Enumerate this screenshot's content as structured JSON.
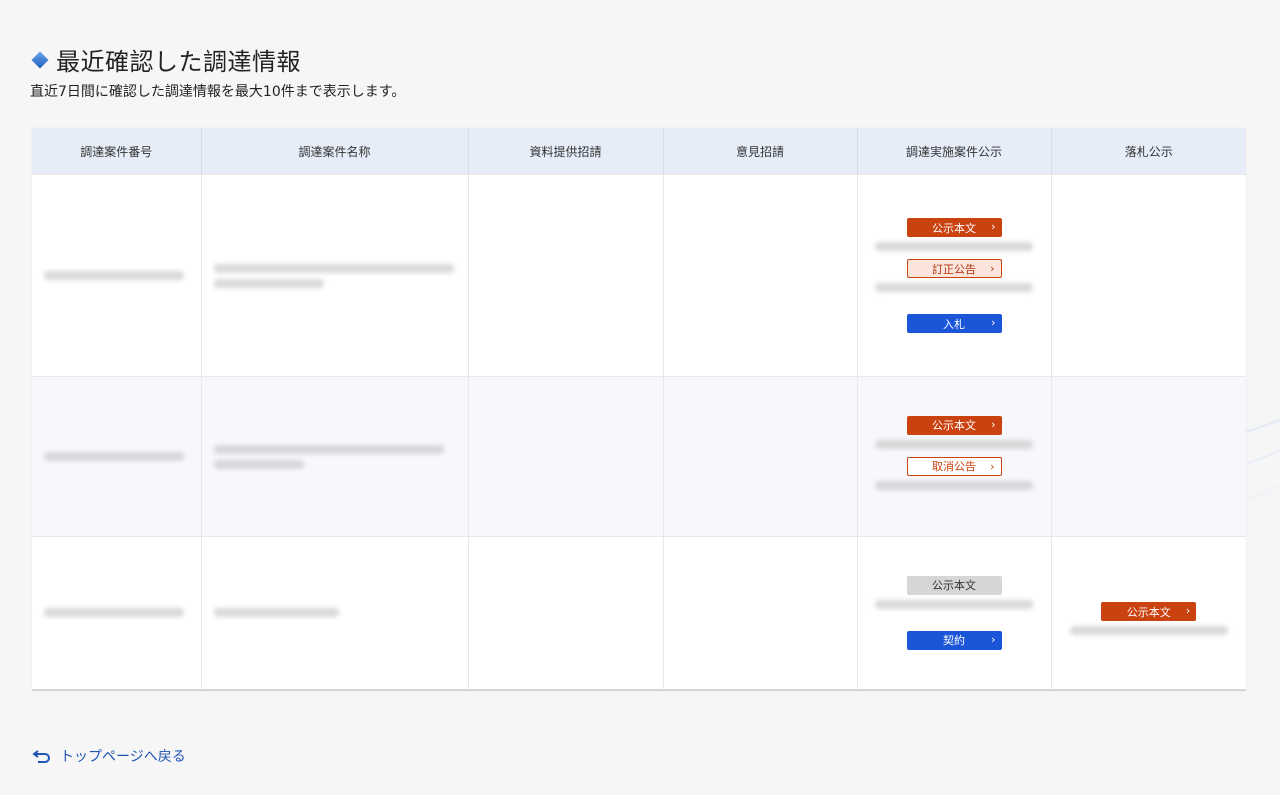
{
  "header": {
    "title": "最近確認した調達情報",
    "subtitle": "直近7日間に確認した調達情報を最大10件まで表示します。"
  },
  "table": {
    "columns": [
      "調達案件番号",
      "調達案件名称",
      "資料提供招請",
      "意見招請",
      "調達実施案件公示",
      "落札公示"
    ],
    "rows": [
      {
        "implementation_buttons": [
          "公示本文",
          "訂正公告",
          "入札"
        ],
        "award_buttons": []
      },
      {
        "implementation_buttons": [
          "公示本文",
          "取消公告"
        ],
        "award_buttons": []
      },
      {
        "implementation_buttons": [
          "公示本文",
          "契約"
        ],
        "award_buttons": [
          "公示本文"
        ]
      }
    ]
  },
  "footer": {
    "back_link": "トップページへ戻る"
  },
  "colors": {
    "accent_orange": "#c9420f",
    "accent_blue": "#1c56d8",
    "header_bg": "#e6edf8"
  }
}
